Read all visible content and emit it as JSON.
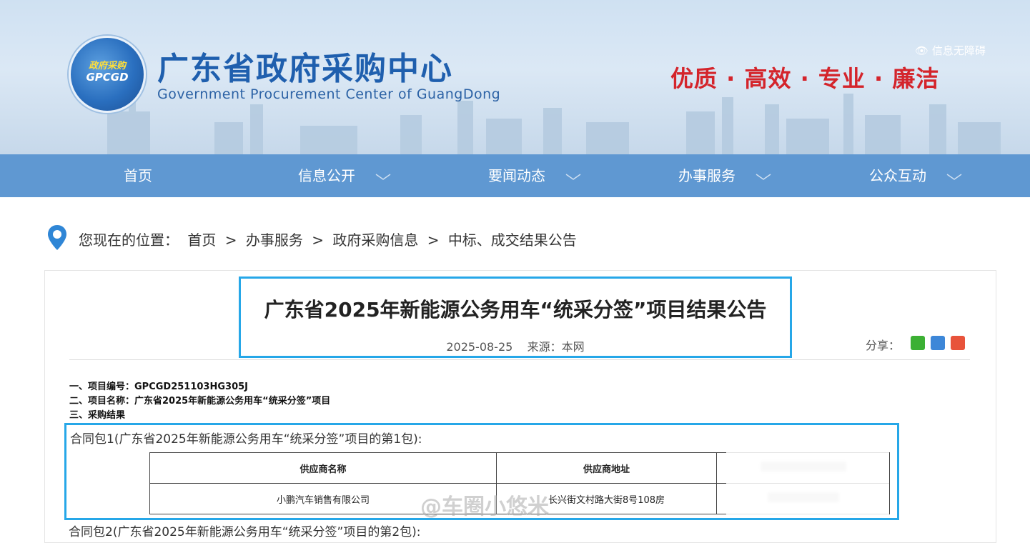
{
  "header": {
    "logo_top": "政府采购",
    "logo_text": "GPCGD",
    "title": "广东省政府采购中心",
    "subtitle": "Government Procurement Center of GuangDong",
    "accessibility": "信息无障碍",
    "slogan": "优质 · 高效 · 专业 · 廉洁"
  },
  "nav": {
    "items": [
      {
        "label": "首页",
        "has_dropdown": false
      },
      {
        "label": "信息公开",
        "has_dropdown": true
      },
      {
        "label": "要闻动态",
        "has_dropdown": true
      },
      {
        "label": "办事服务",
        "has_dropdown": true
      },
      {
        "label": "公众互动",
        "has_dropdown": true
      }
    ]
  },
  "breadcrumb": {
    "prefix": "您现在的位置：",
    "items": [
      "首页",
      "办事服务",
      "政府采购信息",
      "中标、成交结果公告"
    ],
    "separator": ">"
  },
  "article": {
    "title": "广东省2025年新能源公务用车“统采分签”项目结果公告",
    "date": "2025-08-25",
    "source": "来源：本网",
    "share_label": "分享：",
    "info_lines": [
      "一、项目编号：GPCGD251103HG305J",
      "二、项目名称：广东省2025年新能源公务用车“统采分签”项目",
      "三、采购结果"
    ],
    "package_title": "合同包1(广东省2025年新能源公务用车“统采分签”项目的第1包):",
    "table": {
      "headers": [
        "供应商名称",
        "供应商地址"
      ],
      "rows": [
        {
          "name": "小鹏汽车销售有限公司",
          "address": "长兴街文村路大街8号108房"
        }
      ]
    },
    "next_package_partial": "合同包2(广东省2025年新能源公务用车“统采分签”项目的第2包):"
  },
  "watermark": "@车圈小悠米",
  "colors": {
    "nav_bg": "#5f98d2",
    "title_blue": "#1f5fae",
    "slogan_red": "#d4242b",
    "highlight_box": "#26a7e8"
  }
}
